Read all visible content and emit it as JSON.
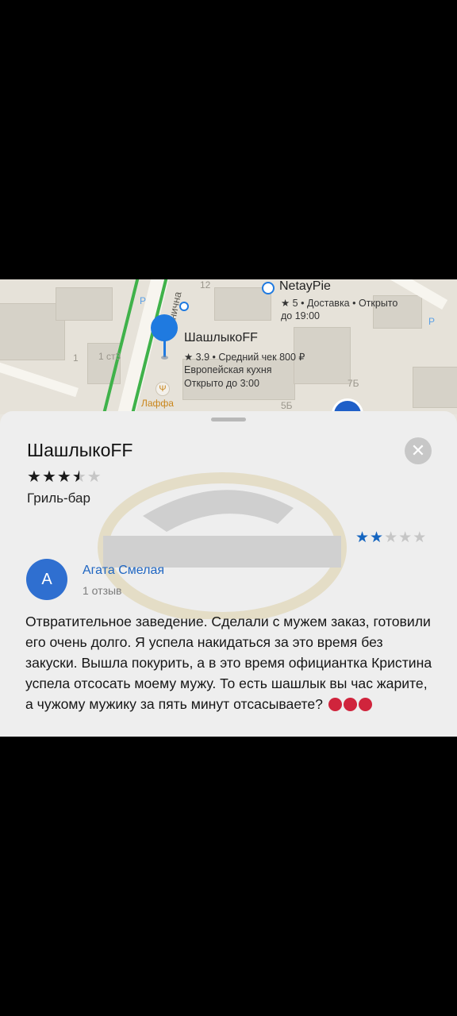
{
  "map": {
    "street_name": "анична",
    "labels": {
      "house_12": "12",
      "house_1": "1",
      "house_1_str3": "1 ст3",
      "house_7b": "7Б",
      "house_5b": "5Б",
      "parking_p": "P",
      "lafa": "Лаффа"
    },
    "poi_netaypie": {
      "name": "NetayPie",
      "line1": "★ 5 • Доставка • Открыто",
      "line2": "до 19:00"
    },
    "poi_selected": {
      "name": "ШашлыкоFF",
      "line1": "★ 3.9 • Средний чек 800 ₽",
      "line2": "Европейская кухня",
      "line3": "Открыто до 3:00"
    },
    "colors": {
      "pin": "#1f7ae0",
      "green_road": "#3fb24a"
    }
  },
  "place": {
    "title": "ШашлыкоFF",
    "rating_stars": 3.5,
    "stars_max": 5,
    "category": "Гриль-бар",
    "close_icon": "close-icon"
  },
  "review": {
    "stars": 2,
    "stars_max": 5,
    "avatar_letter": "А",
    "author": "Агата Смелая",
    "count": "1 отзыв",
    "text": "Отвратительное заведение. Сделали с мужем заказ, готовили его очень долго. Я успела накидаться за это время без закуски. Вышла покурить, а в это время официантка Кристина успела отсосать моему мужу. То есть шашлык вы час жарите, а чужому мужику за пять минут отсасываете?",
    "emoji": "angry-face-icon",
    "emoji_count": 3,
    "colors": {
      "author": "#1f66c2",
      "avatar": "#2f6fd0",
      "stars": "#1565c0"
    }
  }
}
